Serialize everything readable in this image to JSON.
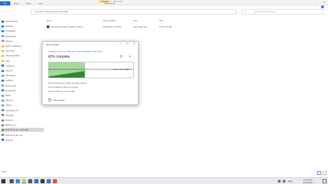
{
  "titlebar": {
    "context_group": "Manage",
    "window_title": "ISO Tools",
    "tabs": [
      "File",
      "Home",
      "Share",
      "View",
      "Drive Tools"
    ],
    "minimize": "–",
    "close": "×"
  },
  "address": {
    "back": "←",
    "forward": "→",
    "up": "↑",
    "path": "› This PC › DVD Drive (D:) CCCOMA",
    "search_placeholder": "Search DVD Drive (D:)",
    "search_icon": "magnifier-icon"
  },
  "nav": {
    "items": [
      {
        "label": "Quick access",
        "color": "#2b74d6"
      },
      {
        "label": "Desktop",
        "color": "#2f8fd8"
      },
      {
        "label": "Downloads",
        "color": "#2f8fd8"
      },
      {
        "label": "Documents",
        "color": "#8aa7c2"
      },
      {
        "label": "Pictures",
        "color": "#6ea7d8"
      },
      {
        "label": "Hyper-V Backups",
        "color": "#e8c25b"
      },
      {
        "label": "ISO Tools",
        "color": "#e8c25b"
      },
      {
        "label": "VM Downloads",
        "color": "#e8c25b"
      },
      {
        "label": "VMs",
        "color": "#e8c25b"
      },
      {
        "label": "OneDrive",
        "color": "#2b74d6"
      },
      {
        "label": "This PC",
        "color": "#3b86d2"
      },
      {
        "label": "3D Objects",
        "color": "#6ea7d8"
      },
      {
        "label": "Desktop",
        "color": "#2f8fd8"
      },
      {
        "label": "Documents",
        "color": "#8aa7c2"
      },
      {
        "label": "Downloads",
        "color": "#2f8fd8"
      },
      {
        "label": "Music",
        "color": "#6ea7d8"
      },
      {
        "label": "Pictures",
        "color": "#6ea7d8"
      },
      {
        "label": "Videos",
        "color": "#6ea7d8"
      },
      {
        "label": "Local Disk (C:)",
        "color": "#8c8c8c"
      },
      {
        "label": "VMs (E:)",
        "color": "#8c8c8c"
      },
      {
        "label": "Data (F:)",
        "color": "#8c8c8c"
      },
      {
        "label": "Backup (G:)",
        "color": "#8c8c8c"
      },
      {
        "label": "DVD Drive (D:) CCCOMA",
        "color": "#8c8c8c"
      },
      {
        "label": "DVD Drive (D:) CC",
        "color": "#8c8c8c"
      },
      {
        "label": "Network",
        "color": "#2b74d6"
      }
    ]
  },
  "columns": {
    "name": "Name",
    "date": "Date modified",
    "type": "Type",
    "size": "Size"
  },
  "files": [
    {
      "name": "Windows10_22H2_English_x64.iso",
      "date": "10/4/2023 11:22 AM",
      "type": "Disc Image File",
      "size": "5,897,712 KB"
    }
  ],
  "status": {
    "item_count": "1 item"
  },
  "dialog": {
    "title": "42% complete",
    "minimize": "–",
    "maximize": "□",
    "close": "×",
    "line1_prefix": "Copying 1 item from ",
    "line1_link": "DVD Drive (D:) CCCOMA",
    "line1_mid": " to ",
    "line1_link2": "ISO Tools",
    "percent": "42% complete",
    "pause": "II",
    "cancel": "×",
    "speed": "Speed: 22.7 MB/s",
    "progress": 0.42,
    "name_line": "Name: Windows10_22H2_English_x64.iso",
    "time_line": "Time remaining: About 2 minutes",
    "items_line": "Items remaining: 1 (3.33 GB)",
    "more_details": "More details",
    "more_icon": "chevron-up-icon"
  },
  "taskbar": {
    "apps": [
      {
        "name": "task-view-icon",
        "color": "#555555"
      },
      {
        "name": "edge-icon",
        "color": "#2a8fd8"
      },
      {
        "name": "explorer-icon",
        "color": "#e8c25b"
      },
      {
        "name": "store-icon",
        "color": "#5a5a5a"
      },
      {
        "name": "mail-icon",
        "color": "#2b74d6"
      },
      {
        "name": "terminal-icon",
        "color": "#3b3b3b"
      },
      {
        "name": "notepad-icon",
        "color": "#3a78c2"
      },
      {
        "name": "paint-icon",
        "color": "#e05a2b"
      }
    ],
    "lang": "ENG",
    "time": "11:24 AM",
    "date": "10/4/2023"
  }
}
